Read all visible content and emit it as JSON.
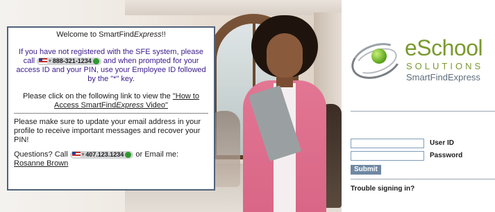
{
  "welcome": {
    "title_prefix": "Welcome to SmartFind",
    "title_italic": "Express",
    "title_suffix": "!!",
    "register_before": "If you have not registered with the SFE system, please call",
    "phone_main": "888-321-1234",
    "register_after": "and when prompted for your access ID and your PIN, use your Employee ID followed by the \"*\" key.",
    "video_intro": "Please click on the following link to view the",
    "video_link_prefix": "\"How to Access SmartFind",
    "video_link_italic": "Express",
    "video_link_suffix": " Video\"",
    "email_note": "Please make sure to update your email address in your profile to receive important messages and recover your PIN!",
    "questions_label": "Questions? Call",
    "phone_questions": "407.123.1234",
    "email_label": "or Email me:",
    "email_contact": "Rosanne Brown"
  },
  "logo": {
    "brand": "eSchool",
    "tagline": "SOLUTIONS",
    "product": "SmartFindExpress",
    "accent_color": "#7a9a2f"
  },
  "login": {
    "user_id_label": "User ID",
    "password_label": "Password",
    "user_id_value": "",
    "password_value": "",
    "submit_label": "Submit",
    "trouble_link": "Trouble signing in?"
  },
  "icons": {
    "flag": "us-flag-icon",
    "chevron": "chevron-down-icon",
    "call": "call-icon"
  }
}
